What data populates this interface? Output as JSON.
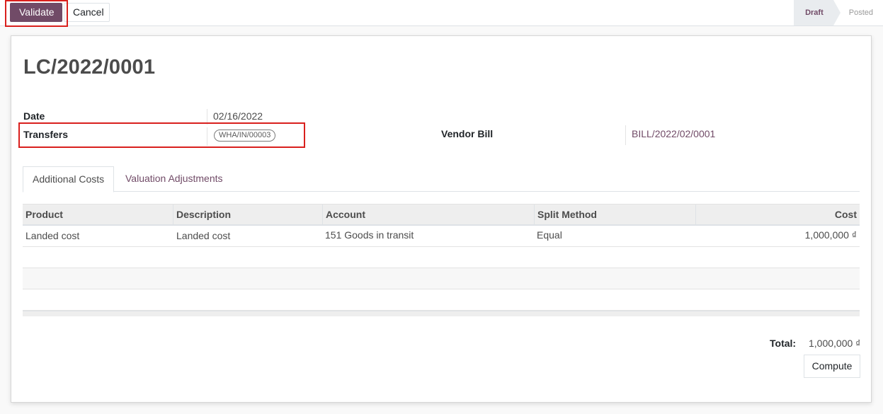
{
  "toolbar": {
    "validate_label": "Validate",
    "cancel_label": "Cancel"
  },
  "statusbar": {
    "steps": [
      {
        "label": "Draft",
        "active": true
      },
      {
        "label": "Posted",
        "active": false
      }
    ]
  },
  "form": {
    "title": "LC/2022/0001",
    "date_label": "Date",
    "date_value": "02/16/2022",
    "transfers_label": "Transfers",
    "transfers_tag": "WHA/IN/00003",
    "vendor_bill_label": "Vendor Bill",
    "vendor_bill_value": "BILL/2022/02/0001"
  },
  "tabs": [
    {
      "label": "Additional Costs",
      "active": true
    },
    {
      "label": "Valuation Adjustments",
      "active": false
    }
  ],
  "table": {
    "columns": [
      "Product",
      "Description",
      "Account",
      "Split Method",
      "Cost"
    ],
    "rows": [
      {
        "product": "Landed cost",
        "description": "Landed cost",
        "account": "151 Goods in transit",
        "split_method": "Equal",
        "cost": "1,000,000 ₫"
      }
    ]
  },
  "summary": {
    "total_label": "Total:",
    "total_value": "1,000,000 ₫",
    "compute_label": "Compute"
  },
  "colors": {
    "primary": "#714b67",
    "highlight": "#d9201d"
  }
}
